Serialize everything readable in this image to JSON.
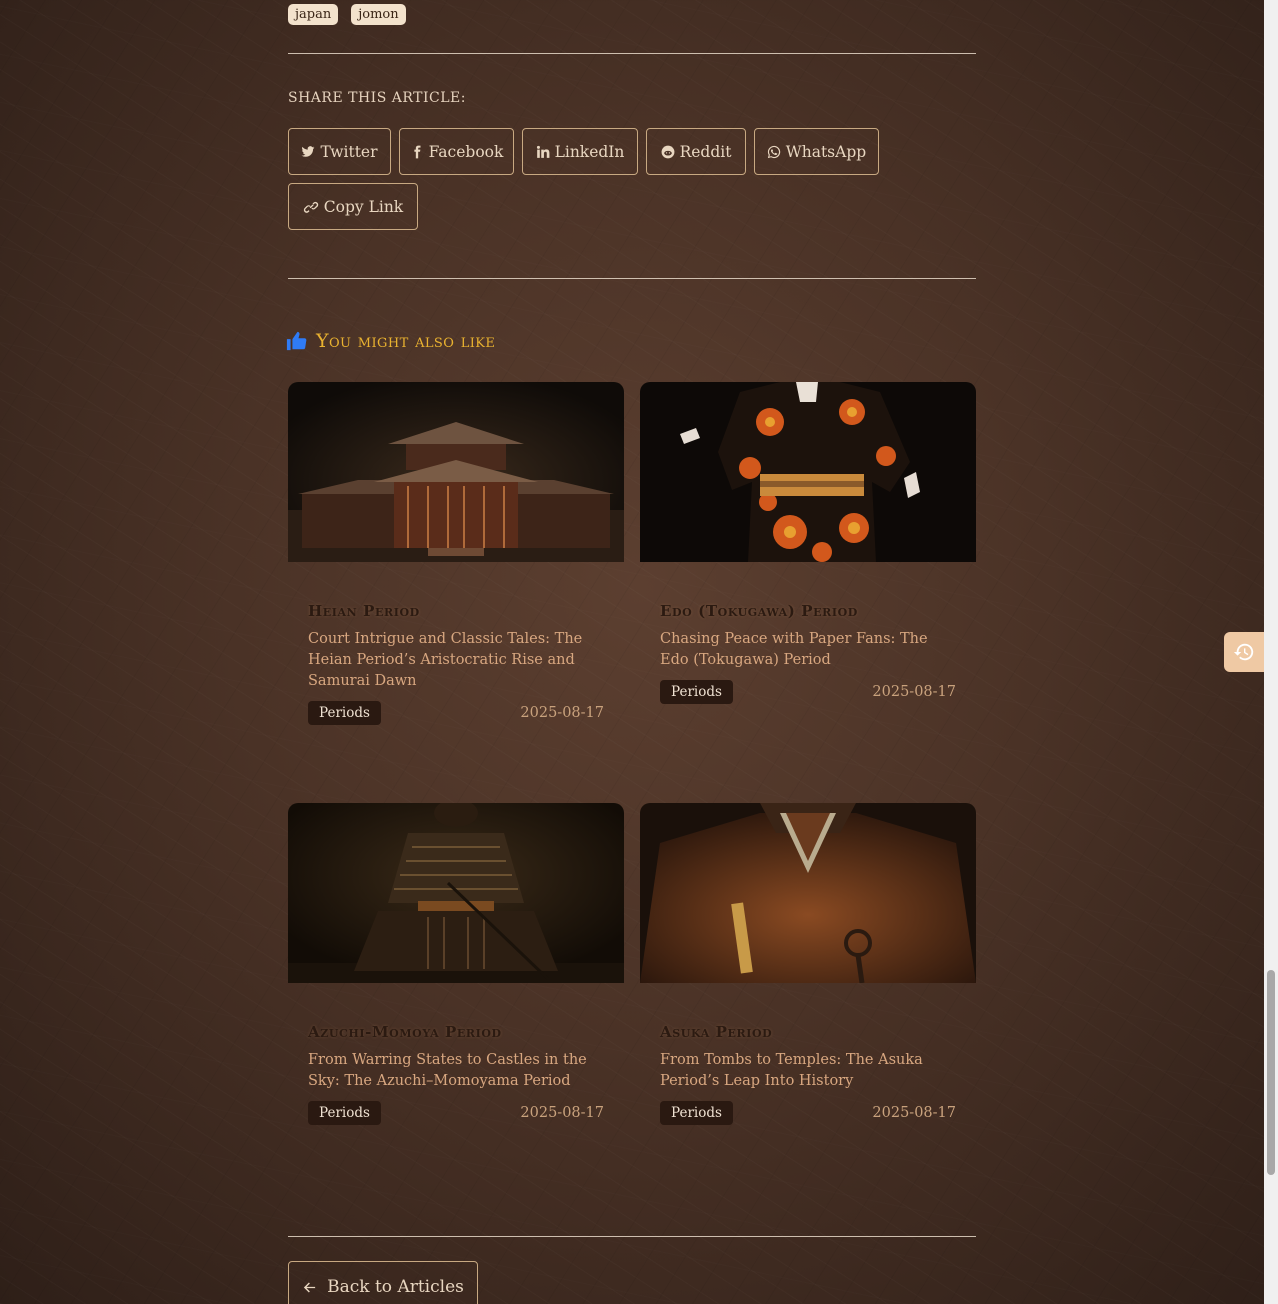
{
  "tags": [
    "japan",
    "jomon"
  ],
  "share": {
    "label": "Share this article:",
    "buttons": [
      {
        "icon": "twitter-icon",
        "label": "Twitter"
      },
      {
        "icon": "facebook-icon",
        "label": "Facebook"
      },
      {
        "icon": "linkedin-icon",
        "label": "LinkedIn"
      },
      {
        "icon": "reddit-icon",
        "label": "Reddit"
      },
      {
        "icon": "whatsapp-icon",
        "label": "WhatsApp"
      },
      {
        "icon": "link-icon",
        "label": "Copy Link"
      }
    ]
  },
  "related": {
    "title": "You might also like",
    "icon": "thumbs-up-icon",
    "cards": [
      {
        "category": "Heian Period",
        "title": "Court Intrigue and Classic Tales: The Heian Period’s Aristocratic Rise and Samurai Dawn",
        "badge": "Periods",
        "date": "2025-08-17",
        "image": "temple"
      },
      {
        "category": "Edo (Tokugawa) Period",
        "title": "Chasing Peace with Paper Fans: The Edo (Tokugawa) Period",
        "badge": "Periods",
        "date": "2025-08-17",
        "image": "kimono"
      },
      {
        "category": "Azuchi-Momoya Period",
        "title": "From Warring States to Castles in the Sky: The Azuchi–Momoyama Period",
        "badge": "Periods",
        "date": "2025-08-17",
        "image": "samurai"
      },
      {
        "category": "Asuka Period",
        "title": "From Tombs to Temples: The Asuka Period’s Leap Into History",
        "badge": "Periods",
        "date": "2025-08-17",
        "image": "monk"
      }
    ]
  },
  "back": {
    "label": "Back to Articles",
    "icon": "arrow-left-icon"
  },
  "floating": {
    "icon": "history-icon"
  },
  "colors": {
    "accent": "#e9b230",
    "background": "#4a3226",
    "badge": "#2a1911",
    "tag": "#f3e2cc"
  }
}
